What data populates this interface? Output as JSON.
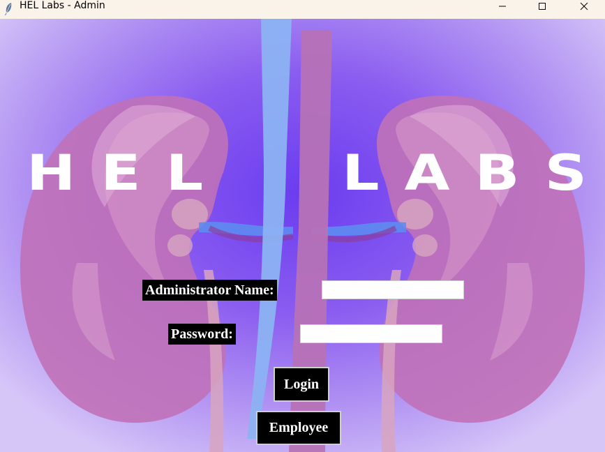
{
  "window": {
    "title": "HEL Labs - Admin",
    "icons": {
      "app": "feather-icon",
      "minimize": "minimize-icon",
      "maximize": "maximize-icon",
      "close": "close-icon"
    }
  },
  "logo": {
    "left": "HEL",
    "right": "LABS"
  },
  "form": {
    "admin_label": "Administrator Name:",
    "admin_value": "",
    "password_label": "Password:",
    "password_value": ""
  },
  "buttons": {
    "login": "Login",
    "employee": "Employee"
  },
  "colors": {
    "title_bar": "#faf3ea",
    "background_center": "#6a3cf0",
    "background_edge": "#d6c6f8",
    "kidney": "#c070b8",
    "ureter_blue": "#8ab4f0",
    "ureter_pink": "#b873b5",
    "label_bg": "#000000",
    "label_text": "#ffffff"
  }
}
